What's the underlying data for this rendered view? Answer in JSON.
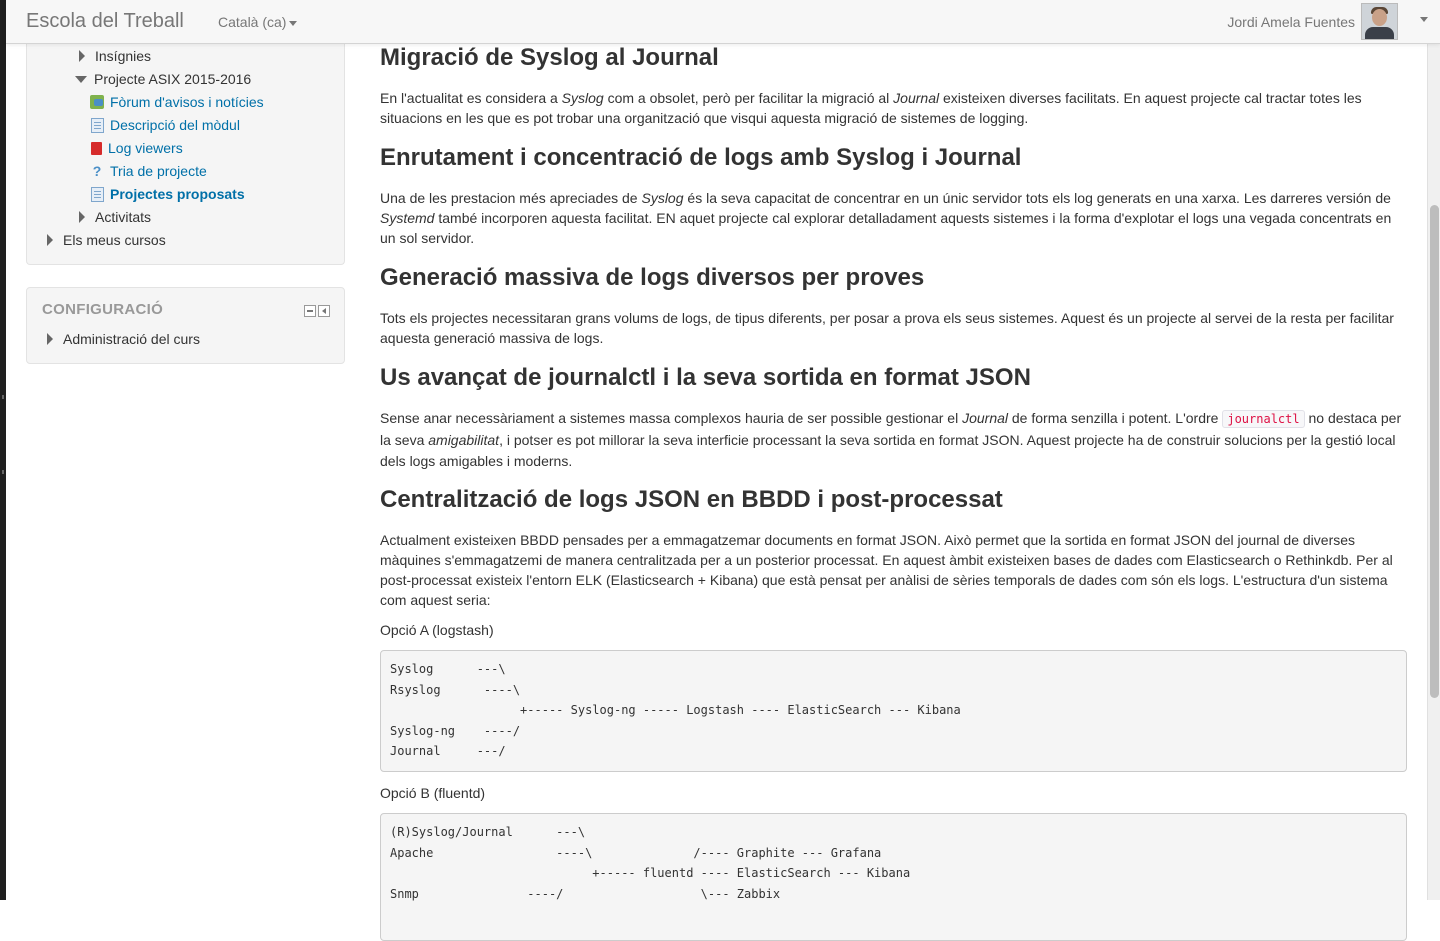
{
  "navbar": {
    "brand": "Escola del Treball",
    "language": "Català (ca)",
    "user_name": "Jordi Amela Fuentes"
  },
  "sidebar": {
    "nav_items": [
      {
        "label": "Insígnies",
        "icon": "triangle-right"
      },
      {
        "label": "Projecte ASIX 2015-2016",
        "icon": "triangle-down"
      },
      {
        "label": "Fòrum d'avisos i notícies",
        "icon": "forum-icon"
      },
      {
        "label": "Descripció del mòdul",
        "icon": "page-icon"
      },
      {
        "label": "Log viewers",
        "icon": "pdf-icon"
      },
      {
        "label": "Tria de projecte",
        "icon": "choice-icon"
      },
      {
        "label": "Projectes proposats",
        "icon": "page-icon"
      },
      {
        "label": "Activitats",
        "icon": "triangle-right"
      },
      {
        "label": "Els meus cursos",
        "icon": "triangle-right"
      }
    ],
    "config": {
      "title": "CONFIGURACIÓ",
      "item": "Administració del curs"
    }
  },
  "content": {
    "s1": {
      "title": "Migració de Syslog al Journal",
      "p_a": "En l'actualitat es considera a ",
      "p_b": "Syslog",
      "p_c": " com a obsolet, però per facilitar la migració al ",
      "p_d": "Journal",
      "p_e": " existeixen diverses facilitats. En aquest projecte cal tractar totes les situacions en les que es pot trobar una organització que visqui aquesta migració de sistemes de logging."
    },
    "s2": {
      "title": "Enrutament i concentració de logs amb Syslog i Journal",
      "p_a": "Una de les prestacion més apreciades de ",
      "p_b": "Syslog",
      "p_c": " és la seva capacitat de concentrar en un únic servidor tots els log generats en una xarxa. Les darreres versión de ",
      "p_d": "Systemd",
      "p_e": " també incorporen aquesta facilitat. EN aquet projecte cal explorar detalladament aquests sistemes i la forma d'explotar el logs una vegada concentrats en un sol servidor."
    },
    "s3": {
      "title": "Generació massiva de logs diversos per proves",
      "p": "Tots els projectes necessitaran grans volums de logs, de tipus diferents, per posar a prova els seus sistemes. Aquest és un projecte al servei de la resta per facilitar aquesta generació massiva de logs."
    },
    "s4": {
      "title": "Us avançat de journalctl i la seva sortida en format JSON",
      "p_a": "Sense anar necessàriament a sistemes massa complexos hauria de ser possible gestionar el ",
      "p_b": "Journal",
      "p_c": " de forma senzilla i potent. L'ordre ",
      "p_code": "journalctl",
      "p_d": " no destaca per la seva ",
      "p_e": "amigabilitat",
      "p_f": ", i potser es pot millorar la seva interficie processant la seva sortida en format JSON. Aquest projecte ha de construir solucions per la gestió local dels logs amigables i moderns."
    },
    "s5": {
      "title": "Centralització de logs JSON en BBDD i post-processat",
      "p": "Actualment existeixen BBDD pensades per a emmagatzemar documents en format JSON. Això permet que la sortida en format JSON del journal de diverses màquines s'emmagatzemi de manera centralitzada per a un posterior processat. En aquest àmbit existeixen bases de dades com Elasticsearch o Rethinkdb. Per al post-processat existeix l'entorn ELK (Elasticsearch + Kibana) que està pensat per anàlisi de sèries temporals de dades com són els logs. L'estructura d'un sistema com aquest seria:",
      "option_a": "Opció A (logstash)",
      "code_a": "Syslog      ---\\\nRsyslog      ----\\\n                  +----- Syslog-ng ----- Logstash ---- ElasticSearch --- Kibana\nSyslog-ng    ----/\nJournal     ---/",
      "option_b": "Opció B (fluentd)",
      "code_b": "(R)Syslog/Journal      ---\\\nApache                 ----\\              /---- Graphite --- Grafana\n                            +----- fluentd ---- ElasticSearch --- Kibana\nSnmp               ----/                   \\--- Zabbix"
    }
  }
}
